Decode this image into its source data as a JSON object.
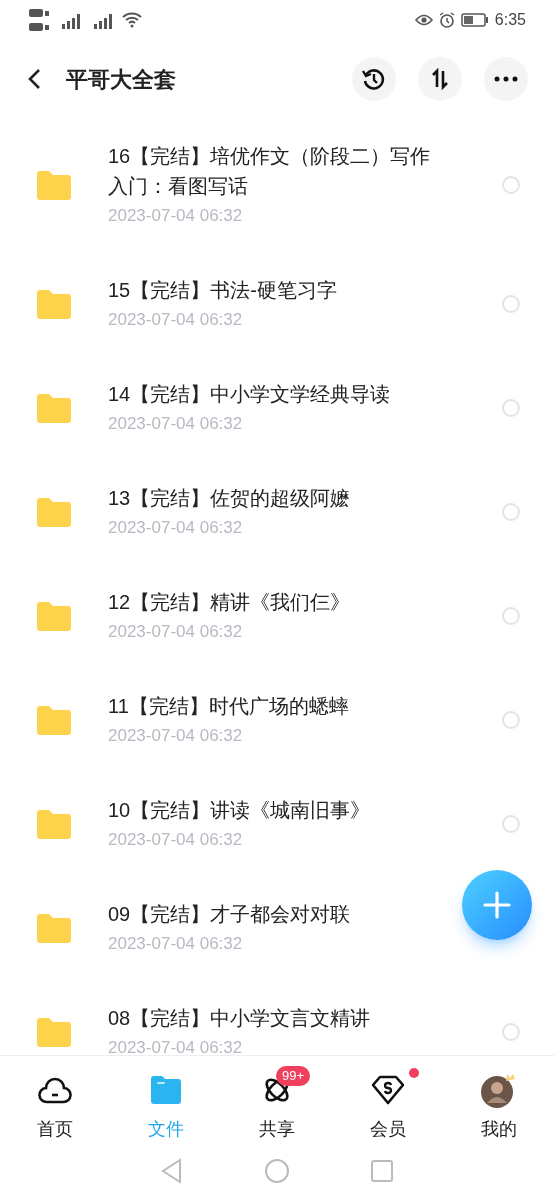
{
  "status_bar": {
    "time": "6:35"
  },
  "header": {
    "title": "平哥大全套"
  },
  "files": [
    {
      "name": "16【完结】培优作文（阶段二）写作入门：看图写话",
      "date": "2023-07-04  06:32",
      "selected": false
    },
    {
      "name": "15【完结】书法-硬笔习字",
      "date": "2023-07-04  06:32",
      "selected": false
    },
    {
      "name": "14【完结】中小学文学经典导读",
      "date": "2023-07-04  06:32",
      "selected": false
    },
    {
      "name": "13【完结】佐贺的超级阿嬷",
      "date": "2023-07-04  06:32",
      "selected": false
    },
    {
      "name": "12【完结】精讲《我们仨》",
      "date": "2023-07-04  06:32",
      "selected": false
    },
    {
      "name": "11【完结】时代广场的蟋蟀",
      "date": "2023-07-04  06:32",
      "selected": false
    },
    {
      "name": "10【完结】讲读《城南旧事》",
      "date": "2023-07-04  06:32",
      "selected": false
    },
    {
      "name": "09【完结】才子都会对对联",
      "date": "2023-07-04  06:32"
    },
    {
      "name": "08【完结】中小学文言文精讲",
      "date": "2023-07-04  06:32",
      "selected": false
    }
  ],
  "tabs": [
    {
      "label": "首页",
      "kind": "home",
      "selected": false
    },
    {
      "label": "文件",
      "kind": "files",
      "selected": true
    },
    {
      "label": "共享",
      "kind": "share",
      "selected": false,
      "badge": "99+"
    },
    {
      "label": "会员",
      "kind": "vip",
      "selected": false,
      "dot": true
    },
    {
      "label": "我的",
      "kind": "me",
      "selected": false
    }
  ]
}
